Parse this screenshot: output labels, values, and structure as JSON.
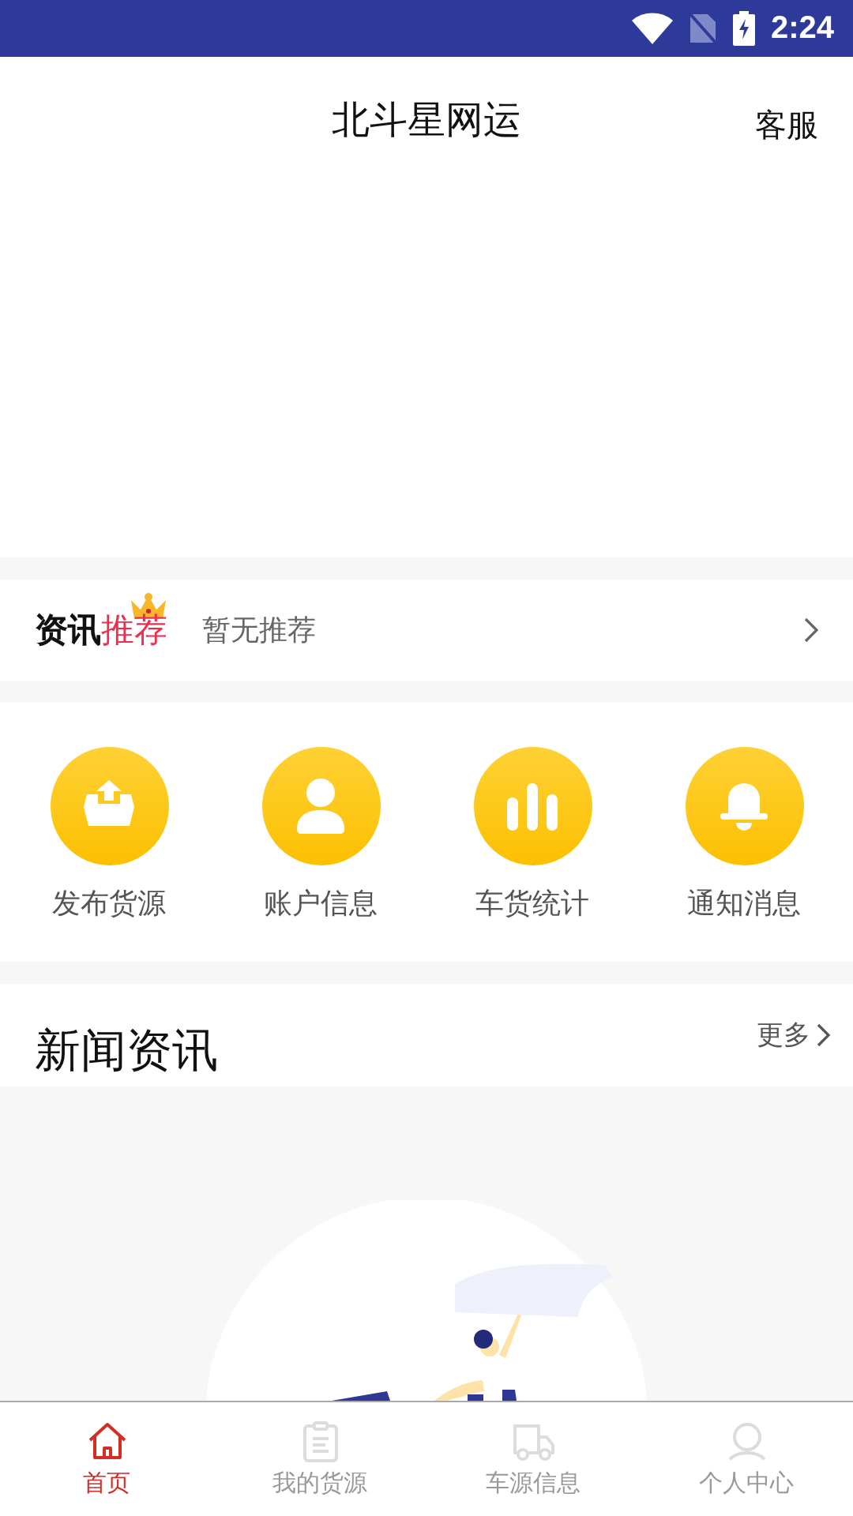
{
  "status_bar": {
    "time": "2:24"
  },
  "header": {
    "title": "北斗星网运",
    "action": "客服"
  },
  "recommend": {
    "title_parts": [
      {
        "text": "资讯",
        "accent": false
      },
      {
        "text": "推荐",
        "accent": true
      }
    ],
    "message": "暂无推荐"
  },
  "shortcuts": [
    {
      "label": "发布货源"
    },
    {
      "label": "账户信息"
    },
    {
      "label": "车货统计"
    },
    {
      "label": "通知消息"
    }
  ],
  "news": {
    "title": "新闻资讯",
    "more": "更多"
  },
  "bottom_nav": [
    {
      "label": "首页",
      "selected": true
    },
    {
      "label": "我的货源",
      "selected": false
    },
    {
      "label": "车源信息",
      "selected": false
    },
    {
      "label": "个人中心",
      "selected": false
    }
  ]
}
